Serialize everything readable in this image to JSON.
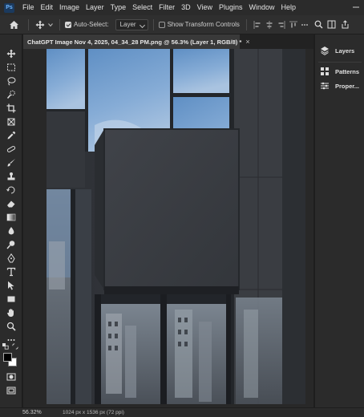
{
  "app": {
    "logo_text": "Ps"
  },
  "menu": [
    "File",
    "Edit",
    "Image",
    "Layer",
    "Type",
    "Select",
    "Filter",
    "3D",
    "View",
    "Plugins",
    "Window",
    "Help"
  ],
  "options_bar": {
    "auto_select_label": "Auto-Select:",
    "auto_select_checked": true,
    "auto_select_target": "Layer",
    "show_transform_label": "Show Transform Controls",
    "show_transform_checked": false
  },
  "document": {
    "tab_title": "ChatGPT Image Nov 4, 2025, 04_34_28 PM.png @ 56.3% (Layer 1, RGB/8) *",
    "close_glyph": "×"
  },
  "status": {
    "zoom": "56.32%",
    "doc_info": "1024 px x 1536 px (72 ppi)"
  },
  "panels": {
    "layers": "Layers",
    "patterns": "Patterns",
    "properties": "Proper..."
  },
  "colors": {
    "foreground": "#000000",
    "background": "#ffffff",
    "ui_bg": "#2b2b2b",
    "canvas_bg": "#282828"
  },
  "tools": [
    "move-icon",
    "marquee-icon",
    "lasso-icon",
    "quick-select-icon",
    "crop-icon",
    "frame-icon",
    "eyedropper-icon",
    "spot-heal-icon",
    "brush-icon",
    "stamp-icon",
    "history-brush-icon",
    "eraser-icon",
    "gradient-icon",
    "blur-icon",
    "dodge-icon",
    "pen-icon",
    "type-icon",
    "path-select-icon",
    "rectangle-icon",
    "hand-icon",
    "zoom-icon",
    "more-tools-icon",
    "quick-mask-icon",
    "screen-mode-icon"
  ]
}
